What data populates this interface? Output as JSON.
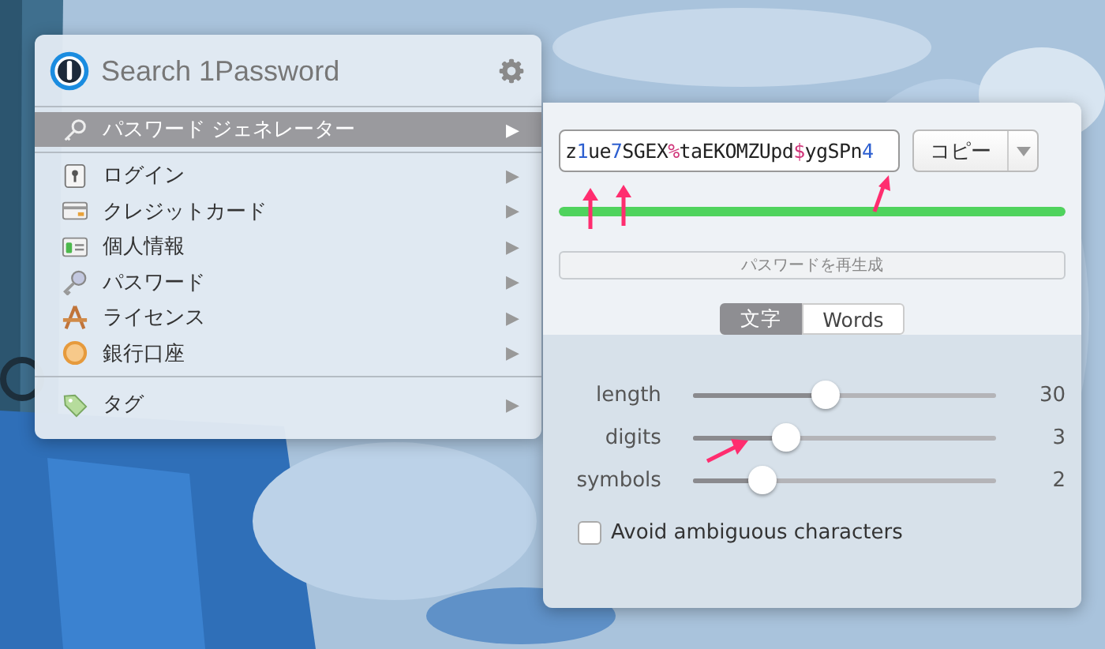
{
  "menu": {
    "search": {
      "placeholder": "Search 1Password"
    },
    "generator": {
      "label": "パスワード ジェネレーター",
      "arrow": "▶",
      "selected": true
    },
    "items": [
      {
        "kind": "login",
        "label": "ログイン",
        "arrow": "▶"
      },
      {
        "kind": "card",
        "label": "クレジットカード",
        "arrow": "▶"
      },
      {
        "kind": "identity",
        "label": "個人情報",
        "arrow": "▶"
      },
      {
        "kind": "password",
        "label": "パスワード",
        "arrow": "▶"
      },
      {
        "kind": "license",
        "label": "ライセンス",
        "arrow": "▶"
      },
      {
        "kind": "bank",
        "label": "銀行口座",
        "arrow": "▶"
      }
    ],
    "tags": {
      "kind": "tag",
      "label": "タグ",
      "arrow": "▶"
    }
  },
  "generator": {
    "password": [
      {
        "kind": "letter",
        "text": "z"
      },
      {
        "kind": "digit",
        "text": "1"
      },
      {
        "kind": "letter",
        "text": "ue"
      },
      {
        "kind": "digit",
        "text": "7"
      },
      {
        "kind": "letter",
        "text": "SGEX"
      },
      {
        "kind": "symbol",
        "text": "%"
      },
      {
        "kind": "letter",
        "text": "taEKOMZUpd"
      },
      {
        "kind": "symbol",
        "text": "$"
      },
      {
        "kind": "letter",
        "text": "ygSPn"
      },
      {
        "kind": "digit",
        "text": "4"
      }
    ],
    "copy_button": "コピー",
    "strength": {
      "level": 1
    },
    "regenerate_button": "パスワードを再生成",
    "modes": [
      {
        "label": "文字",
        "selected": true
      },
      {
        "label": "Words",
        "selected": false
      }
    ],
    "sliders": [
      {
        "label": "length",
        "level": 0.44,
        "value": "30"
      },
      {
        "label": "digits",
        "level": 0.31,
        "value": "3"
      },
      {
        "label": "symbols",
        "level": 0.23,
        "value": "2"
      }
    ],
    "avoid_ambiguous": {
      "label": "Avoid ambiguous characters",
      "checked": false
    }
  }
}
